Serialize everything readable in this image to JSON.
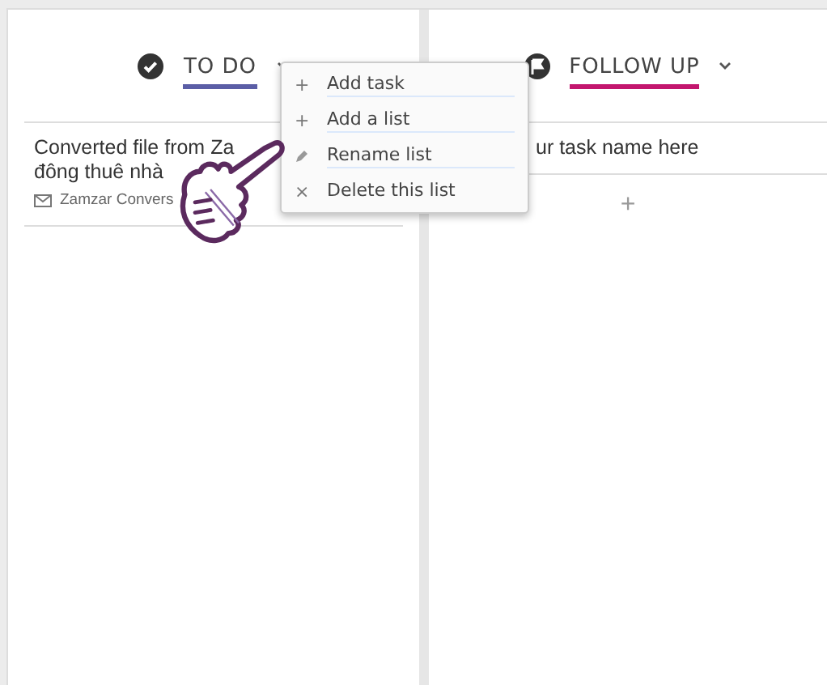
{
  "lists": [
    {
      "title": "TO DO",
      "color": "#5b5ea6",
      "cards": [
        {
          "title_lines": [
            "Converted file from Za",
            "đông thuê nhà"
          ],
          "source": "Zamzar Convers"
        }
      ]
    },
    {
      "title": "FOLLOW UP",
      "color": "#c3166e",
      "input_value": "ur task name here",
      "add_label": "+"
    }
  ],
  "menu": {
    "items": [
      {
        "kind": "glyph",
        "icon": "+",
        "label": "Add task"
      },
      {
        "kind": "glyph",
        "icon": "+",
        "label": "Add a list"
      },
      {
        "kind": "pencil",
        "label": "Rename list"
      },
      {
        "kind": "glyph",
        "icon": "×",
        "label": "Delete this list"
      }
    ]
  },
  "pointer": {
    "kind": "hand"
  }
}
